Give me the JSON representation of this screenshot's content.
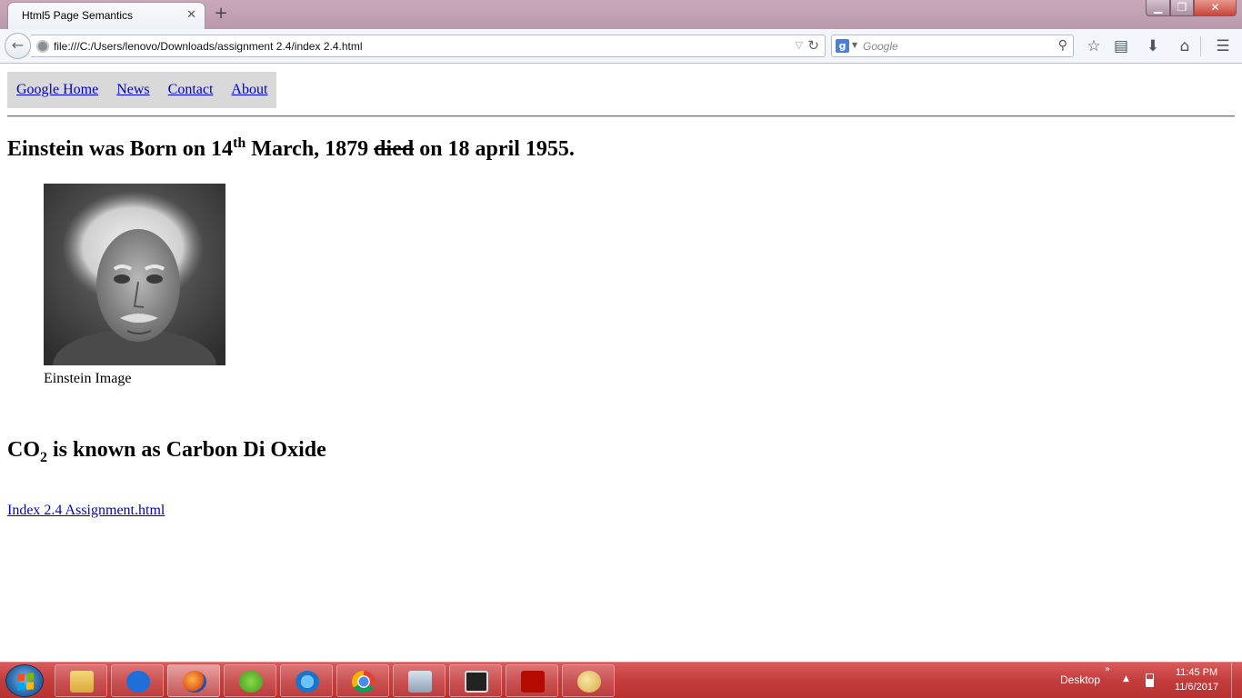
{
  "browser": {
    "tab_title": "Html5 Page Semantics",
    "tab_close": "✕",
    "new_tab": "+",
    "window_min": "▁",
    "window_max": "❐",
    "window_close": "✕",
    "url": "file:///C:/Users/lenovo/Downloads/assignment 2.4/index 2.4.html",
    "search_placeholder": "Google",
    "search_engine_letter": "g",
    "icons": [
      "back-icon",
      "site-identity-icon",
      "url-dropdown-icon",
      "reload-icon",
      "search-go-icon",
      "bookmark-star-icon",
      "reading-list-icon",
      "downloads-icon",
      "home-icon",
      "menu-icon"
    ]
  },
  "page": {
    "nav": {
      "links": [
        "Google Home",
        "News",
        "Contact",
        "About"
      ]
    },
    "heading1": {
      "part1": "Einstein was Born on 14",
      "sup": "th",
      "part2": " March, 1879 ",
      "struck": "died",
      "part3": " on 18 april 1955."
    },
    "figure": {
      "caption": "Einstein Image"
    },
    "heading2": {
      "part1": "CO",
      "sub": "2",
      "part2": " is known as Carbon Di Oxide"
    },
    "footer_link": "Index 2.4 Assignment.html"
  },
  "taskbar": {
    "apps": [
      "file-explorer",
      "teamviewer",
      "firefox",
      "green-app",
      "internet-explorer",
      "chrome",
      "calculator",
      "terminal",
      "acrobat-reader",
      "paint"
    ],
    "active_app": "firefox",
    "desktop_label": "Desktop",
    "chevron": "»",
    "time": "11:45 PM",
    "date": "11/6/2017"
  },
  "colors": {
    "link": "#0000cc",
    "nav_bg": "#d9d9d9",
    "taskbar": "#c43d3d",
    "titlebar": "#c9a9b9"
  }
}
